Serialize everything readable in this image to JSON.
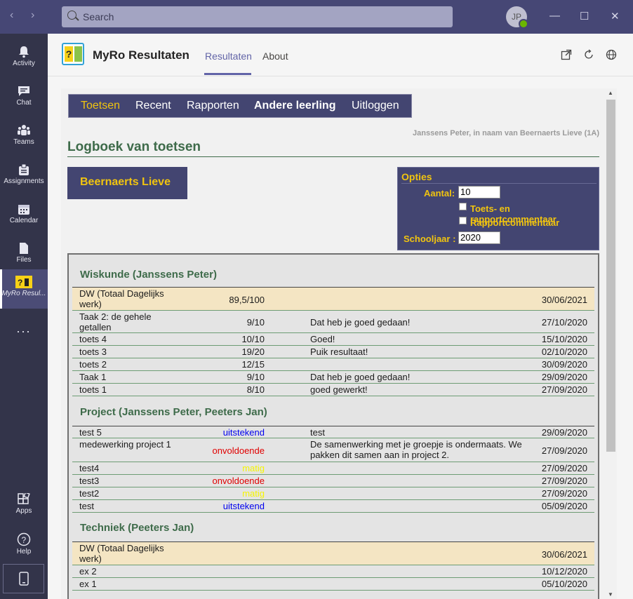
{
  "search": {
    "placeholder": "Search"
  },
  "user": {
    "initials": "JP"
  },
  "rail": [
    {
      "label": "Activity",
      "icon": "bell-icon"
    },
    {
      "label": "Chat",
      "icon": "chat-icon"
    },
    {
      "label": "Teams",
      "icon": "teams-icon"
    },
    {
      "label": "Assignments",
      "icon": "assignments-icon"
    },
    {
      "label": "Calendar",
      "icon": "calendar-icon"
    },
    {
      "label": "Files",
      "icon": "file-icon"
    },
    {
      "label": "MyRo Resul...",
      "icon": "myro-app-icon"
    },
    {
      "label": "...",
      "icon": "more-icon"
    },
    {
      "label": "Apps",
      "icon": "apps-icon"
    },
    {
      "label": "Help",
      "icon": "help-icon"
    }
  ],
  "app": {
    "name": "MyRo Resultaten",
    "tabs": [
      "Resultaten",
      "About"
    ],
    "active_tab": "Resultaten"
  },
  "menu": [
    "Toetsen",
    "Recent",
    "Rapporten",
    "Andere leerling",
    "Uitloggen"
  ],
  "user_line": "Janssens Peter, in naam van Beernaerts Lieve (1A)",
  "page_title": "Logboek van toetsen",
  "student": "Beernaerts Lieve",
  "opties": {
    "title": "Opties",
    "aantal_label": "Aantal:",
    "aantal_value": "10",
    "cb1_label": "Toets- en rapportcommentaar",
    "cb2_label": "Rapportcommentaar",
    "schooljaar_label": "Schooljaar :",
    "schooljaar_value": "2020"
  },
  "colors": {
    "header": "#464775",
    "rail": "#33344a",
    "accent": "#6264a7",
    "menu": "#434571",
    "gold": "#f1c40f",
    "green": "#3e6b4a",
    "blue": "#0000ee",
    "red": "#e00000",
    "yellow": "#f5f500"
  },
  "sections": [
    {
      "title": "Wiskunde (Janssens Peter)",
      "rows": [
        {
          "name": "DW (Totaal Dagelijks werk)",
          "score": "89,5/100",
          "comment": "",
          "date": "30/06/2021",
          "total": true
        },
        {
          "name": "Taak 2: de gehele getallen",
          "score": "9/10",
          "comment": "Dat heb je goed gedaan!",
          "date": "27/10/2020"
        },
        {
          "name": "toets 4",
          "score": "10/10",
          "comment": "Goed!",
          "date": "15/10/2020"
        },
        {
          "name": "toets 3",
          "score": "19/20",
          "comment": "Puik resultaat!",
          "date": "02/10/2020"
        },
        {
          "name": "toets 2",
          "score": "12/15",
          "comment": "",
          "date": "30/09/2020"
        },
        {
          "name": "Taak 1",
          "score": "9/10",
          "comment": "Dat heb je goed gedaan!",
          "date": "29/09/2020"
        },
        {
          "name": "toets 1",
          "score": "8/10",
          "comment": "goed gewerkt!",
          "date": "27/09/2020"
        }
      ]
    },
    {
      "title": "Project (Janssens Peter, Peeters Jan)",
      "rows": [
        {
          "name": "test 5",
          "score": "uitstekend",
          "color": "#0000ee",
          "comment": "test",
          "date": "29/09/2020"
        },
        {
          "name": "medewerking project 1",
          "score": "onvoldoende",
          "color": "#e00000",
          "comment": "De samenwerking met je groepje is ondermaats. We pakken dit samen aan in project 2.",
          "date": "27/09/2020"
        },
        {
          "name": "test4",
          "score": "matig",
          "color": "#f5f500",
          "comment": "",
          "date": "27/09/2020"
        },
        {
          "name": "test3",
          "score": "onvoldoende",
          "color": "#e00000",
          "comment": "",
          "date": "27/09/2020"
        },
        {
          "name": "test2",
          "score": "matig",
          "color": "#f5f500",
          "comment": "",
          "date": "27/09/2020"
        },
        {
          "name": "test",
          "score": "uitstekend",
          "color": "#0000ee",
          "comment": "",
          "date": "05/09/2020"
        }
      ]
    },
    {
      "title": "Techniek (Peeters Jan)",
      "rows": [
        {
          "name": "DW (Totaal Dagelijks werk)",
          "score": "",
          "comment": "",
          "date": "30/06/2021",
          "total": true
        },
        {
          "name": "ex 2",
          "score": "",
          "comment": "",
          "date": "10/12/2020"
        },
        {
          "name": "ex 1",
          "score": "",
          "comment": "",
          "date": "05/10/2020"
        }
      ]
    }
  ]
}
